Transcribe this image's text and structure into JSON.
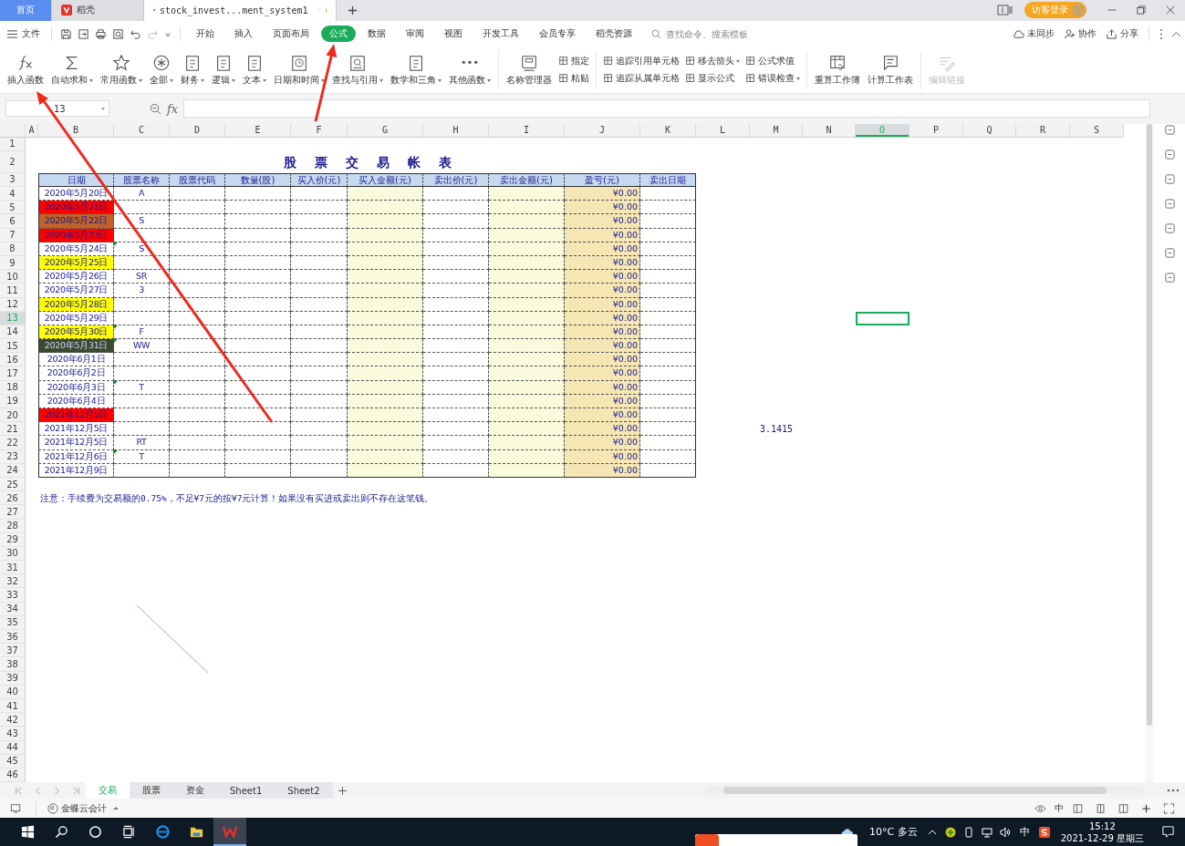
{
  "tabs": [
    {
      "label": "首页",
      "kind": "home",
      "selected": false
    },
    {
      "label": "稻壳",
      "kind": "docer",
      "selected": false
    },
    {
      "label": "stock_invest...ment_system1",
      "kind": "sheet",
      "selected": true
    }
  ],
  "login_button": "访客登录",
  "menu": {
    "file": "文件",
    "tabs": [
      {
        "label": "开始",
        "selected": false
      },
      {
        "label": "插入",
        "selected": false
      },
      {
        "label": "页面布局",
        "selected": false
      },
      {
        "label": "公式",
        "selected": true
      },
      {
        "label": "数据",
        "selected": false
      },
      {
        "label": "审阅",
        "selected": false
      },
      {
        "label": "视图",
        "selected": false
      },
      {
        "label": "开发工具",
        "selected": false
      },
      {
        "label": "会员专享",
        "selected": false
      },
      {
        "label": "稻壳资源",
        "selected": false
      }
    ],
    "search": {
      "placeholder": "查找命令、搜索模板"
    },
    "actions": [
      {
        "label": "未同步"
      },
      {
        "label": "协作"
      },
      {
        "label": "分享"
      }
    ]
  },
  "ribbon": [
    {
      "kind": "large",
      "label": "插入函数",
      "dropdown": false,
      "disabled": false
    },
    {
      "kind": "large",
      "label": "自动求和",
      "dropdown": true,
      "disabled": false
    },
    {
      "kind": "large",
      "label": "常用函数",
      "dropdown": true,
      "disabled": false
    },
    {
      "kind": "large",
      "label": "全部",
      "dropdown": true,
      "disabled": false
    },
    {
      "kind": "large",
      "label": "财务",
      "dropdown": true,
      "disabled": false
    },
    {
      "kind": "large",
      "label": "逻辑",
      "dropdown": true,
      "disabled": false
    },
    {
      "kind": "large",
      "label": "文本",
      "dropdown": true,
      "disabled": false
    },
    {
      "kind": "large",
      "label": "日期和时间",
      "dropdown": true,
      "disabled": false
    },
    {
      "kind": "large",
      "label": "查找与引用",
      "dropdown": true,
      "disabled": false
    },
    {
      "kind": "large",
      "label": "数学和三角",
      "dropdown": true,
      "disabled": false
    },
    {
      "kind": "large",
      "label": "其他函数",
      "dropdown": true,
      "disabled": false
    },
    {
      "kind": "divider"
    },
    {
      "kind": "large",
      "label": "名称管理器",
      "dropdown": false,
      "disabled": false
    },
    {
      "kind": "stack",
      "items": [
        {
          "label": "指定",
          "dropdown": false
        },
        {
          "label": "粘贴",
          "dropdown": false
        }
      ]
    },
    {
      "kind": "divider"
    },
    {
      "kind": "stack",
      "items": [
        {
          "label": "追踪引用单元格",
          "dropdown": false
        },
        {
          "label": "追踪从属单元格",
          "dropdown": false
        }
      ]
    },
    {
      "kind": "stack",
      "items": [
        {
          "label": "移去箭头",
          "dropdown": true
        },
        {
          "label": "显示公式",
          "dropdown": false
        }
      ]
    },
    {
      "kind": "stack",
      "items": [
        {
          "label": "公式求值",
          "dropdown": false
        },
        {
          "label": "错误检查",
          "dropdown": true
        }
      ]
    },
    {
      "kind": "divider"
    },
    {
      "kind": "large",
      "label": "重算工作簿",
      "dropdown": false,
      "disabled": false
    },
    {
      "kind": "large",
      "label": "计算工作表",
      "dropdown": false,
      "disabled": false
    },
    {
      "kind": "divider"
    },
    {
      "kind": "large",
      "label": "编辑链接",
      "dropdown": false,
      "disabled": true
    }
  ],
  "formula_bar": {
    "name_box": "13",
    "fx": "fx"
  },
  "sheet": {
    "column_headers": [
      {
        "label": "A",
        "selected": false
      },
      {
        "label": "B",
        "selected": false
      },
      {
        "label": "C",
        "selected": false
      },
      {
        "label": "D",
        "selected": false
      },
      {
        "label": "E",
        "selected": false
      },
      {
        "label": "F",
        "selected": false
      },
      {
        "label": "G",
        "selected": false
      },
      {
        "label": "H",
        "selected": false
      },
      {
        "label": "I",
        "selected": false
      },
      {
        "label": "J",
        "selected": false
      },
      {
        "label": "K",
        "selected": false
      },
      {
        "label": "L",
        "selected": false
      },
      {
        "label": "M",
        "selected": false
      },
      {
        "label": "N",
        "selected": false
      },
      {
        "label": "O",
        "selected": true
      },
      {
        "label": "P",
        "selected": false
      },
      {
        "label": "Q",
        "selected": false
      },
      {
        "label": "R",
        "selected": false
      },
      {
        "label": "S",
        "selected": false
      }
    ],
    "row_headers": [
      {
        "label": "1",
        "selected": false
      },
      {
        "label": "2",
        "selected": false
      },
      {
        "label": "3",
        "selected": false
      },
      {
        "label": "4",
        "selected": false
      },
      {
        "label": "5",
        "selected": false
      },
      {
        "label": "6",
        "selected": false
      },
      {
        "label": "7",
        "selected": false
      },
      {
        "label": "8",
        "selected": false
      },
      {
        "label": "9",
        "selected": false
      },
      {
        "label": "10",
        "selected": false
      },
      {
        "label": "11",
        "selected": false
      },
      {
        "label": "12",
        "selected": false
      },
      {
        "label": "13",
        "selected": true
      },
      {
        "label": "14",
        "selected": false
      },
      {
        "label": "15",
        "selected": false
      },
      {
        "label": "16",
        "selected": false
      },
      {
        "label": "17",
        "selected": false
      },
      {
        "label": "18",
        "selected": false
      },
      {
        "label": "19",
        "selected": false
      },
      {
        "label": "20",
        "selected": false
      },
      {
        "label": "21",
        "selected": false
      },
      {
        "label": "22",
        "selected": false
      },
      {
        "label": "23",
        "selected": false
      },
      {
        "label": "24",
        "selected": false
      },
      {
        "label": "25",
        "selected": false
      },
      {
        "label": "26",
        "selected": false
      },
      {
        "label": "27",
        "selected": false
      },
      {
        "label": "28",
        "selected": false
      },
      {
        "label": "29",
        "selected": false
      },
      {
        "label": "30",
        "selected": false
      },
      {
        "label": "31",
        "selected": false
      },
      {
        "label": "32",
        "selected": false
      },
      {
        "label": "33",
        "selected": false
      },
      {
        "label": "34",
        "selected": false
      },
      {
        "label": "35",
        "selected": false
      },
      {
        "label": "36",
        "selected": false
      },
      {
        "label": "37",
        "selected": false
      },
      {
        "label": "38",
        "selected": false
      },
      {
        "label": "39",
        "selected": false
      },
      {
        "label": "40",
        "selected": false
      },
      {
        "label": "41",
        "selected": false
      },
      {
        "label": "42",
        "selected": false
      },
      {
        "label": "43",
        "selected": false
      },
      {
        "label": "44",
        "selected": false
      },
      {
        "label": "45",
        "selected": false
      },
      {
        "label": "46",
        "selected": false
      }
    ],
    "title": "股票交易帐表",
    "table": {
      "columns": [
        "日期",
        "股票名称",
        "股票代码",
        "数量(股)",
        "买入价(元)",
        "买入金额(元)",
        "卖出价(元)",
        "卖出金额(元)",
        "盈亏(元)",
        "卖出日期"
      ],
      "rows": [
        {
          "date": "2020年5月20日",
          "stock": "A",
          "profit": "¥0.00",
          "marked": false
        },
        {
          "date": "2020年5月21日",
          "color": "#ff0000",
          "profit": "¥0.00",
          "marked": false
        },
        {
          "date": "2020年5月22日",
          "color": "#c0622a",
          "stock": "S",
          "profit": "¥0.00",
          "marked": false
        },
        {
          "date": "2020年5月23日",
          "color": "#ff0000",
          "profit": "¥0.00",
          "marked": false
        },
        {
          "date": "2020年5月24日",
          "stock": "S",
          "profit": "¥0.00",
          "marked": true
        },
        {
          "date": "2020年5月25日",
          "color": "#ffff00",
          "profit": "¥0.00",
          "marked": false
        },
        {
          "date": "2020年5月26日",
          "stock": "SR",
          "profit": "¥0.00",
          "marked": false
        },
        {
          "date": "2020年5月27日",
          "stock": "3",
          "profit": "¥0.00",
          "marked": false
        },
        {
          "date": "2020年5月28日",
          "color": "#ffff00",
          "profit": "¥0.00",
          "marked": false
        },
        {
          "date": "2020年5月29日",
          "profit": "¥0.00",
          "marked": false
        },
        {
          "date": "2020年5月30日",
          "color": "#ffff00",
          "stock": "F",
          "profit": "¥0.00",
          "marked": true
        },
        {
          "date": "2020年5月31日",
          "color": "#3a4a2e",
          "stock": "WW",
          "profit": "¥0.00",
          "marked": true
        },
        {
          "date": "2020年6月1日",
          "profit": "¥0.00",
          "marked": false
        },
        {
          "date": "2020年6月2日",
          "profit": "¥0.00",
          "marked": false
        },
        {
          "date": "2020年6月3日",
          "stock": "T",
          "profit": "¥0.00",
          "marked": true
        },
        {
          "date": "2020年6月4日",
          "profit": "¥0.00",
          "marked": false
        },
        {
          "date": "2021年12月5日",
          "color": "#ff0000",
          "profit": "¥0.00",
          "marked": false
        },
        {
          "date": "2021年12月5日",
          "profit": "¥0.00",
          "marked": false
        },
        {
          "date": "2021年12月5日",
          "stock": "RT",
          "profit": "¥0.00",
          "marked": false
        },
        {
          "date": "2021年12月6日",
          "stock": "T",
          "profit": "¥0.00",
          "marked": true
        },
        {
          "date": "2021年12月9日",
          "profit": "¥0.00",
          "marked": false
        }
      ]
    },
    "side_value": "3.1415",
    "note": "注意：手续费为交易额的0.75%，不足¥7元的按¥7元计算！如果没有买进或卖出则不存在这笔钱。"
  },
  "sheet_tabs": [
    {
      "label": "交易",
      "selected": true
    },
    {
      "label": "股票",
      "selected": false
    },
    {
      "label": "资金",
      "selected": false
    },
    {
      "label": "Sheet1",
      "selected": false
    },
    {
      "label": "Sheet2",
      "selected": false
    }
  ],
  "status_bar": {
    "app": "金蝶云会计",
    "lang": "中"
  },
  "taskbar": {
    "weather": "10°C 多云",
    "ime": "中",
    "time": "15:12",
    "date": "2021-12-29 星期三"
  }
}
